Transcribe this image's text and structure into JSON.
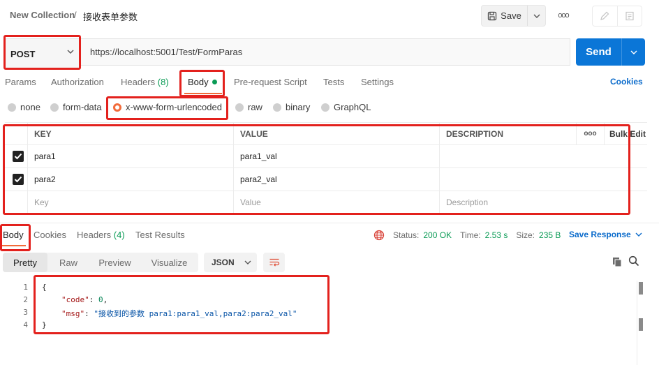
{
  "header": {
    "collection": "New Collection",
    "separator": "/",
    "request_name": "接收表单参数",
    "save_label": "Save",
    "more_label": "ooo"
  },
  "request": {
    "method": "POST",
    "url": "https://localhost:5001/Test/FormParas",
    "send_label": "Send"
  },
  "tabs": {
    "params": "Params",
    "authorization": "Authorization",
    "headers": "Headers",
    "headers_count": "(8)",
    "body": "Body",
    "prerequest": "Pre-request Script",
    "tests": "Tests",
    "settings": "Settings",
    "cookies": "Cookies"
  },
  "body_types": {
    "none": "none",
    "form_data": "form-data",
    "urlencoded": "x-www-form-urlencoded",
    "raw": "raw",
    "binary": "binary",
    "graphql": "GraphQL",
    "selected": "x-www-form-urlencoded"
  },
  "params_table": {
    "headers": {
      "key": "KEY",
      "value": "VALUE",
      "description": "DESCRIPTION",
      "more": "ooo",
      "bulk_edit": "Bulk Edit"
    },
    "rows": [
      {
        "key": "para1",
        "value": "para1_val",
        "description": "",
        "checked": true
      },
      {
        "key": "para2",
        "value": "para2_val",
        "description": "",
        "checked": true
      }
    ],
    "placeholder": {
      "key": "Key",
      "value": "Value",
      "description": "Description"
    }
  },
  "response": {
    "tabs": {
      "body": "Body",
      "cookies": "Cookies",
      "headers": "Headers",
      "headers_count": "(4)",
      "test_results": "Test Results"
    },
    "status_label": "Status:",
    "status_value": "200 OK",
    "time_label": "Time:",
    "time_value": "2.53 s",
    "size_label": "Size:",
    "size_value": "235 B",
    "save_response": "Save Response",
    "views": {
      "pretty": "Pretty",
      "raw": "Raw",
      "preview": "Preview",
      "visualize": "Visualize"
    },
    "format": "JSON",
    "code": {
      "line_numbers": [
        "1",
        "2",
        "3",
        "4"
      ],
      "open_brace": "{",
      "close_brace": "}",
      "code_key": "\"code\"",
      "code_value": "0",
      "msg_key": "\"msg\"",
      "msg_value": "\"接收到的参数 para1:para1_val,para2:para2_val\""
    }
  },
  "colors": {
    "accent": "#f26b3a",
    "primary": "#0b76d7",
    "success": "#0a9b55",
    "annotation": "#e3211d"
  }
}
